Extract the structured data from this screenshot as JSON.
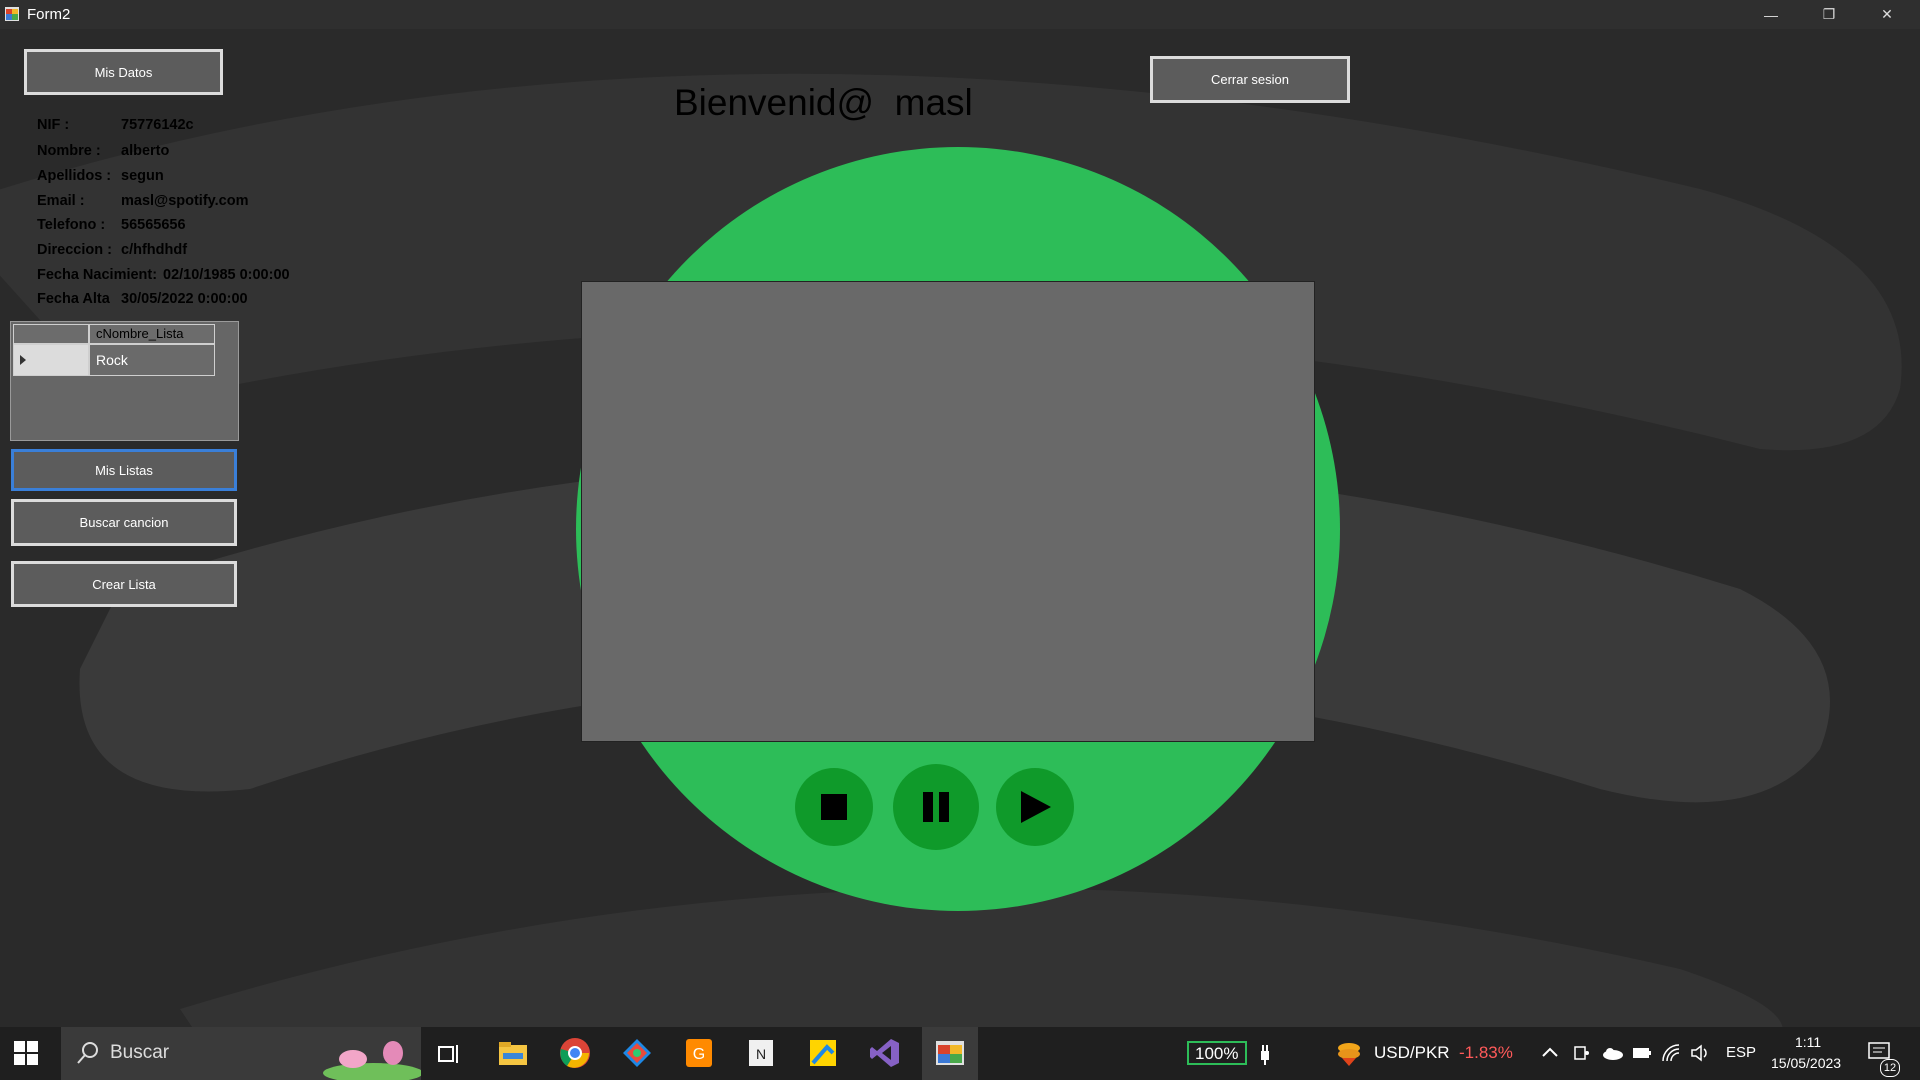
{
  "window": {
    "title": "Form2",
    "minimize": "—",
    "restore": "❐",
    "close": "✕"
  },
  "header": {
    "welcome": "Bienvenid@  masl",
    "my_data_button": "Mis Datos",
    "logout_button": "Cerrar sesion"
  },
  "user_info": [
    {
      "key": "NIF :",
      "value": "75776142c"
    },
    {
      "key": "Nombre :",
      "value": "alberto"
    },
    {
      "key": "Apellidos :",
      "value": "segun"
    },
    {
      "key": "Email :",
      "value": "masl@spotify.com"
    },
    {
      "key": "Telefono :",
      "value": "56565656"
    },
    {
      "key": "Direccion :",
      "value": "c/hfhdhdf"
    },
    {
      "key": "Fecha Nacimient:",
      "value": "02/10/1985 0:00:00"
    },
    {
      "key": "Fecha Alta",
      "value": "30/05/2022 0:00:00"
    }
  ],
  "playlist_grid": {
    "column_header": "cNombre_Lista",
    "rows": [
      "Rock"
    ]
  },
  "sidebar_buttons": {
    "my_lists": "Mis Listas",
    "search_song": "Buscar cancion",
    "create_list": "Crear Lista"
  },
  "taskbar": {
    "search_label": "Buscar",
    "battery": "100%",
    "currency_pair": "USD/PKR",
    "currency_change": "-1.83%",
    "language": "ESP",
    "time": "1:11",
    "date": "15/05/2023",
    "notifications": "12"
  },
  "colors": {
    "accent_green": "#2dbd58",
    "control_green": "#0f9a2a",
    "negative_red": "#ff5a5a"
  }
}
